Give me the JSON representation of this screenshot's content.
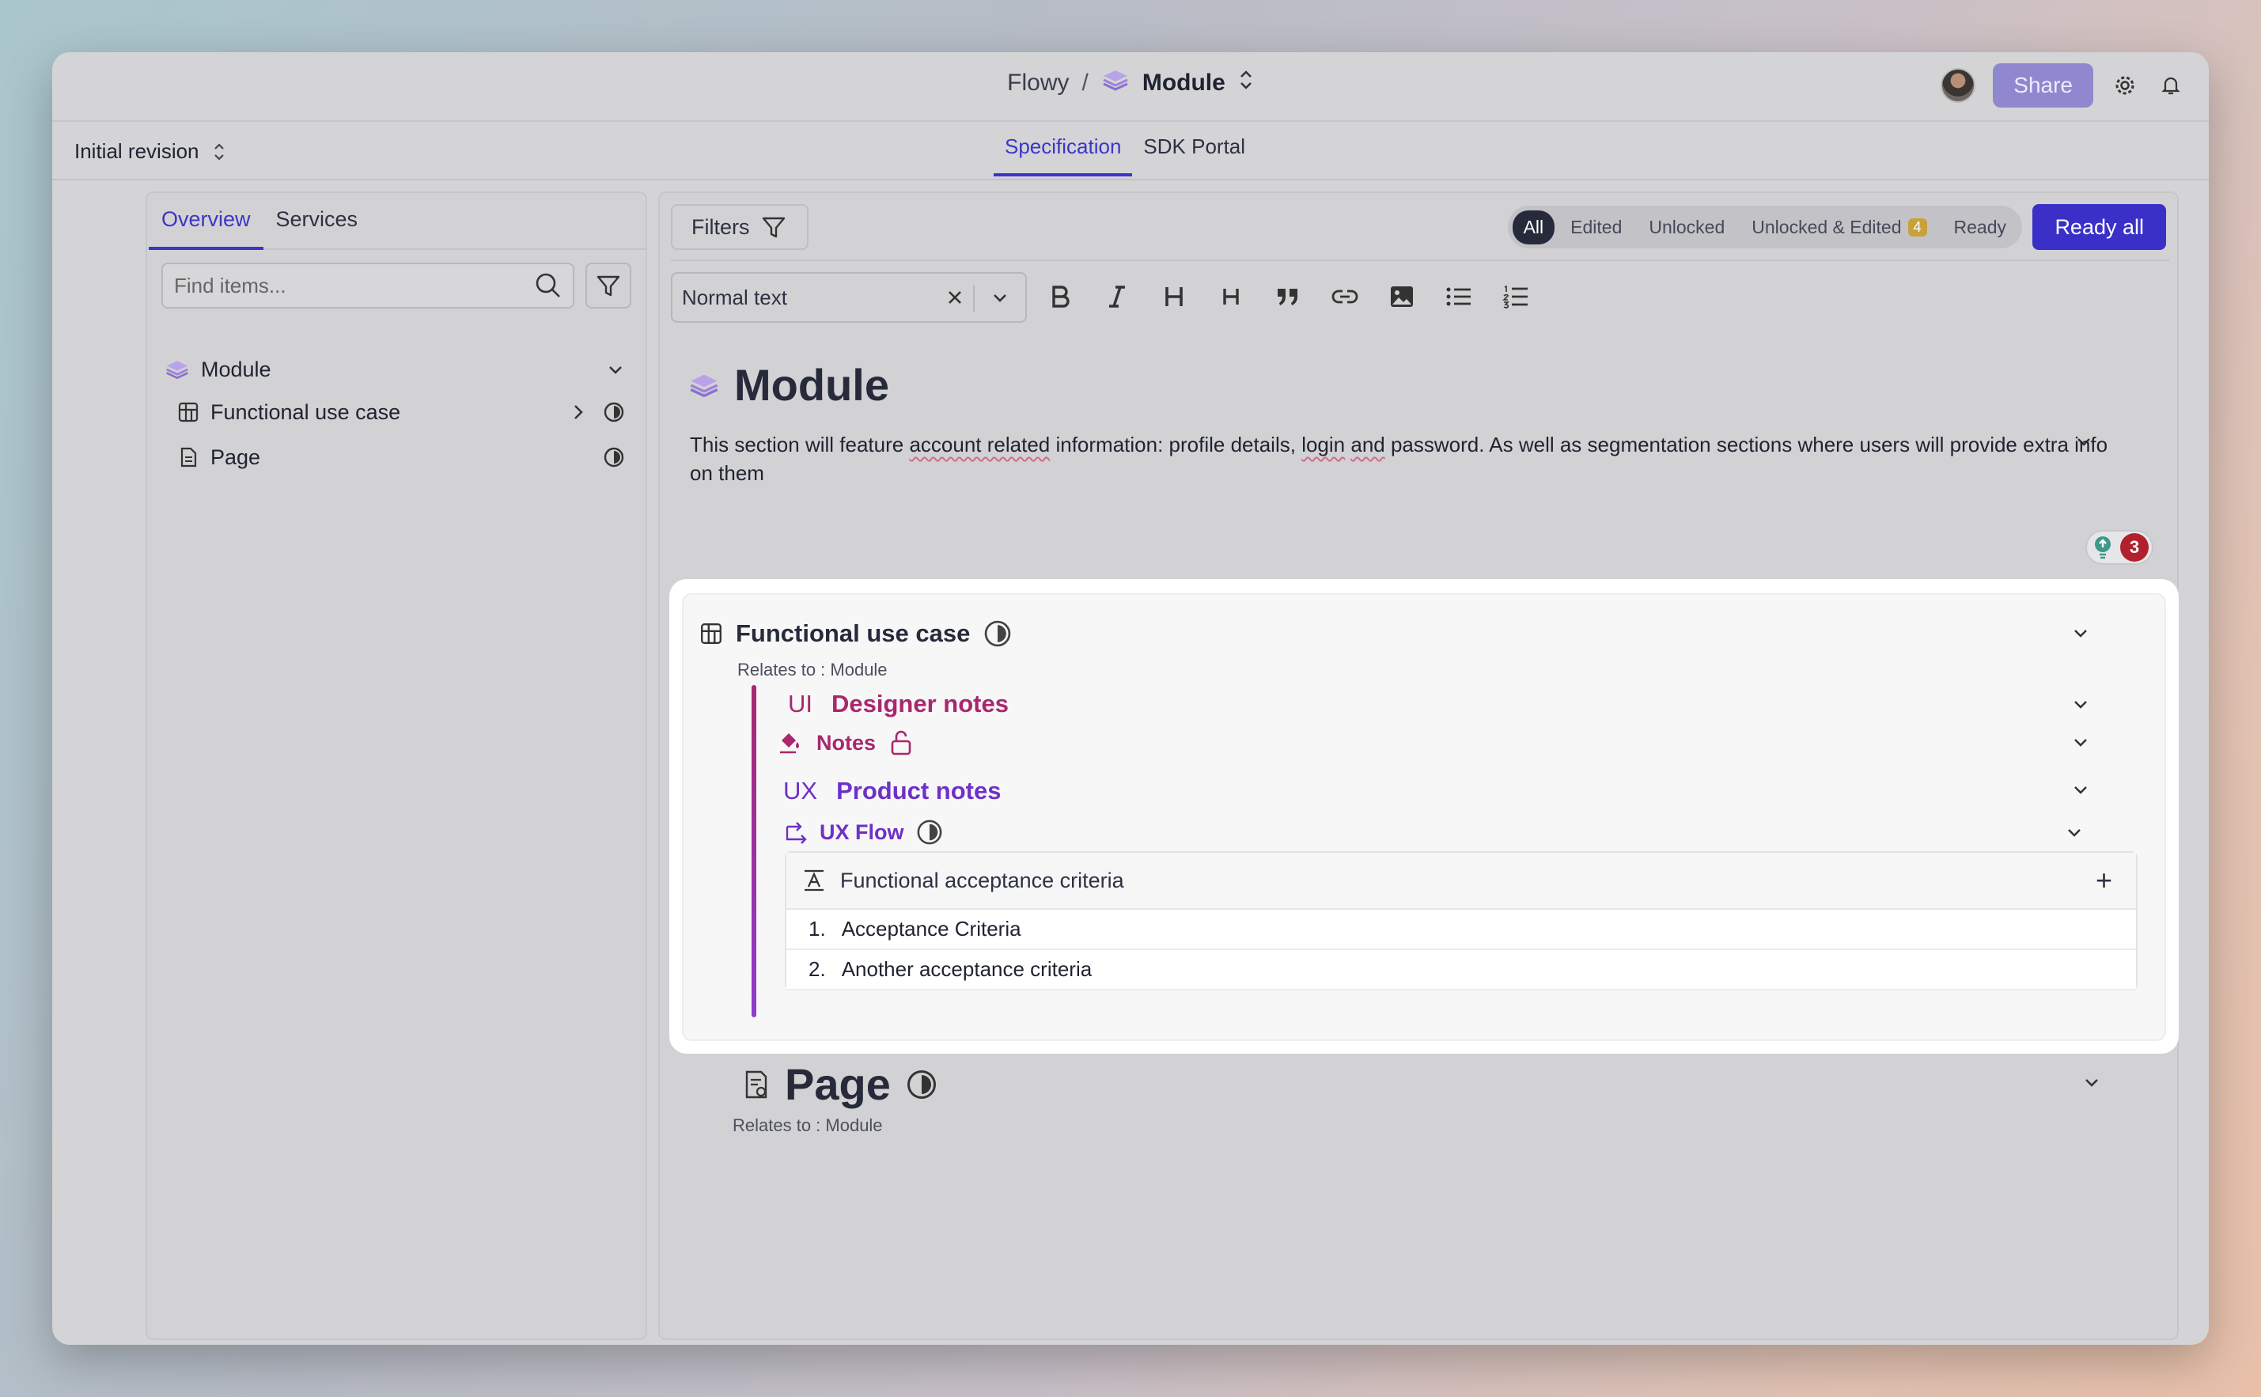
{
  "breadcrumb": {
    "root": "Flowy",
    "separator": "/",
    "current": "Module"
  },
  "topbar": {
    "share_label": "Share"
  },
  "revision": {
    "label": "Initial revision"
  },
  "main_tabs": [
    {
      "label": "Specification",
      "active": true
    },
    {
      "label": "SDK Portal",
      "active": false
    }
  ],
  "left_tabs": [
    {
      "label": "Overview",
      "active": true
    },
    {
      "label": "Services",
      "active": false
    }
  ],
  "search": {
    "placeholder": "Find items..."
  },
  "tree": [
    {
      "label": "Module",
      "icon": "module-icon"
    },
    {
      "label": "Functional use case",
      "icon": "table-icon"
    },
    {
      "label": "Page",
      "icon": "document-icon"
    }
  ],
  "filters": {
    "label": "Filters"
  },
  "status_chips": [
    {
      "label": "All",
      "active": true
    },
    {
      "label": "Edited"
    },
    {
      "label": "Unlocked"
    },
    {
      "label": "Unlocked & Edited",
      "badge": "4"
    },
    {
      "label": "Ready"
    }
  ],
  "ready_all_label": "Ready all",
  "editor": {
    "text_style": "Normal text"
  },
  "module": {
    "title": "Module",
    "description_parts": [
      "This section will feature ",
      "account related",
      " information: profile details, ",
      "login",
      " ",
      "and",
      " password. As well as segmentation sections where users will provide extra info on them"
    ],
    "hint_count": "3"
  },
  "functional_use_case": {
    "title": "Functional use case",
    "relates_to": "Relates to : Module",
    "designer": {
      "tag": "UI",
      "title": "Designer notes",
      "notes_label": "Notes"
    },
    "product": {
      "tag": "UX",
      "title": "Product notes",
      "flow_label": "UX Flow"
    },
    "criteria": {
      "header": "Functional acceptance criteria",
      "items": [
        {
          "num": "1.",
          "text": "Acceptance Criteria"
        },
        {
          "num": "2.",
          "text": "Another acceptance criteria"
        }
      ]
    }
  },
  "page": {
    "title": "Page",
    "relates_to": "Relates to : Module"
  },
  "colors": {
    "accent": "#3b35c9",
    "designer": "#a9276d",
    "product": "#6e30c8",
    "hint_badge": "#b0212d"
  }
}
